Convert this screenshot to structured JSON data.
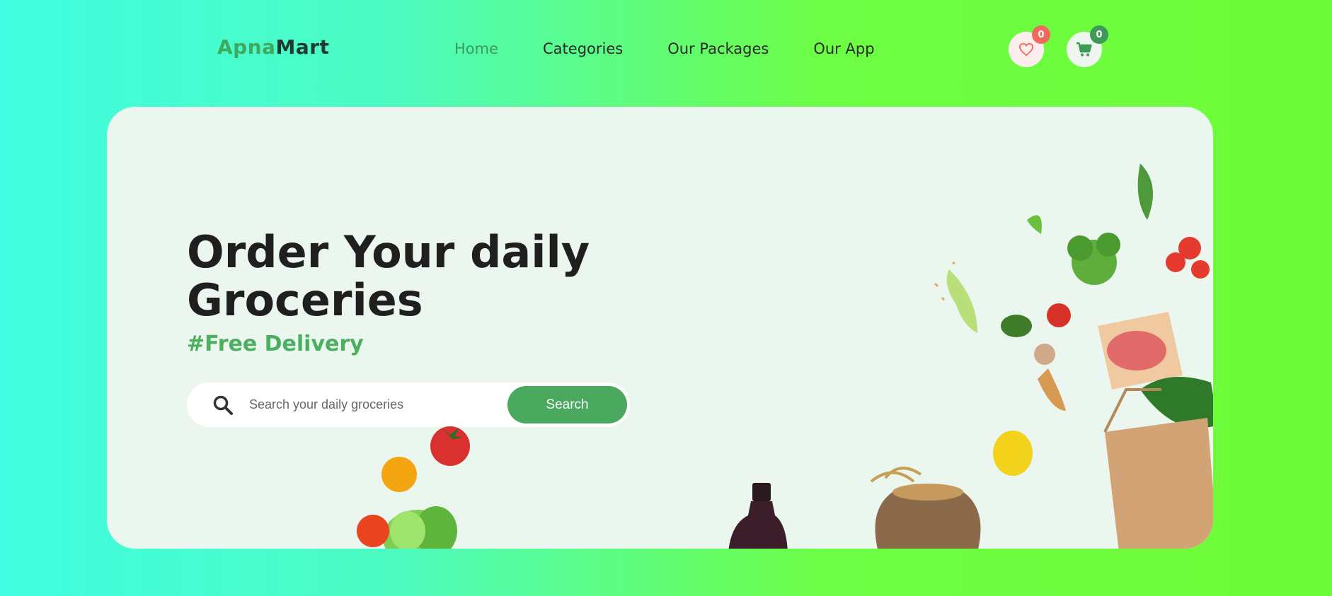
{
  "brand": {
    "part1": "Apna",
    "part2": "Mart"
  },
  "nav": {
    "items": [
      {
        "label": "Home"
      },
      {
        "label": "Categories"
      },
      {
        "label": "Our Packages"
      },
      {
        "label": "Our App"
      }
    ]
  },
  "header_actions": {
    "wishlist_count": "0",
    "cart_count": "0"
  },
  "hero": {
    "title": "Order Your daily Groceries",
    "tagline": "#Free Delivery",
    "search": {
      "placeholder": "Search your daily groceries",
      "value": "",
      "button_label": "Search"
    }
  },
  "colors": {
    "accent": "#4aa95f",
    "badge_red": "#f06a5e",
    "hero_bg": "#eaf6ee"
  },
  "icons": [
    "heart-icon",
    "cart-icon",
    "search-icon"
  ]
}
